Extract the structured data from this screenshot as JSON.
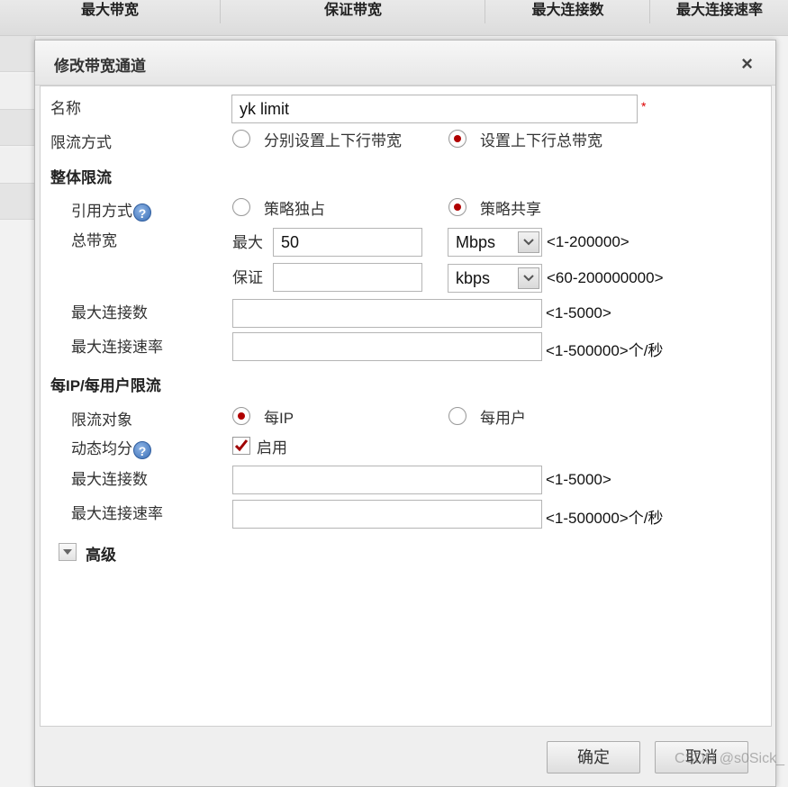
{
  "background_table": {
    "columns": [
      "最大带宽",
      "保证带宽",
      "最大连接数",
      "最大连接速率"
    ]
  },
  "dialog": {
    "title": "修改带宽通道",
    "close_label": "×",
    "confirm_label": "确定",
    "cancel_label": "取消"
  },
  "form": {
    "name_label": "名称",
    "name_value": "yk limit",
    "required_mark": "*",
    "limit_mode_label": "限流方式",
    "limit_mode_options": [
      "分别设置上下行带宽",
      "设置上下行总带宽"
    ],
    "limit_mode_selected": "设置上下行总带宽",
    "overall": {
      "section_title": "整体限流",
      "ref_mode_label": "引用方式",
      "ref_mode_options": [
        "策略独占",
        "策略共享"
      ],
      "ref_mode_selected": "策略共享",
      "total_bw_label": "总带宽",
      "max_label": "最大",
      "max_value": "50",
      "max_unit": "Mbps",
      "max_hint": "<1-200000>",
      "guarantee_label": "保证",
      "guarantee_value": "",
      "guarantee_unit": "kbps",
      "guarantee_hint": "<60-200000000>",
      "max_conn_label": "最大连接数",
      "max_conn_value": "",
      "max_conn_hint": "<1-5000>",
      "max_rate_label": "最大连接速率",
      "max_rate_value": "",
      "max_rate_hint": "<1-500000>个/秒"
    },
    "per_ip": {
      "section_title": "每IP/每用户限流",
      "target_label": "限流对象",
      "target_options": [
        "每IP",
        "每用户"
      ],
      "target_selected": "每IP",
      "dynamic_label": "动态均分",
      "dynamic_enable_label": "启用",
      "dynamic_enabled": true,
      "max_conn_label": "最大连接数",
      "max_conn_value": "",
      "max_conn_hint": "<1-5000>",
      "max_rate_label": "最大连接速率",
      "max_rate_value": "",
      "max_rate_hint": "<1-500000>个/秒"
    },
    "advanced_label": "高级"
  },
  "watermark": "CSDN @s0Sick_",
  "icons": {
    "help": "help-icon",
    "close": "close-icon",
    "dropdown": "chevron-down-icon",
    "expand": "triangle-down-icon",
    "check": "checkmark-icon"
  },
  "colors": {
    "radio_selected": "#b00000",
    "required": "#dd0000",
    "help_icon": "#3b6fb6"
  }
}
